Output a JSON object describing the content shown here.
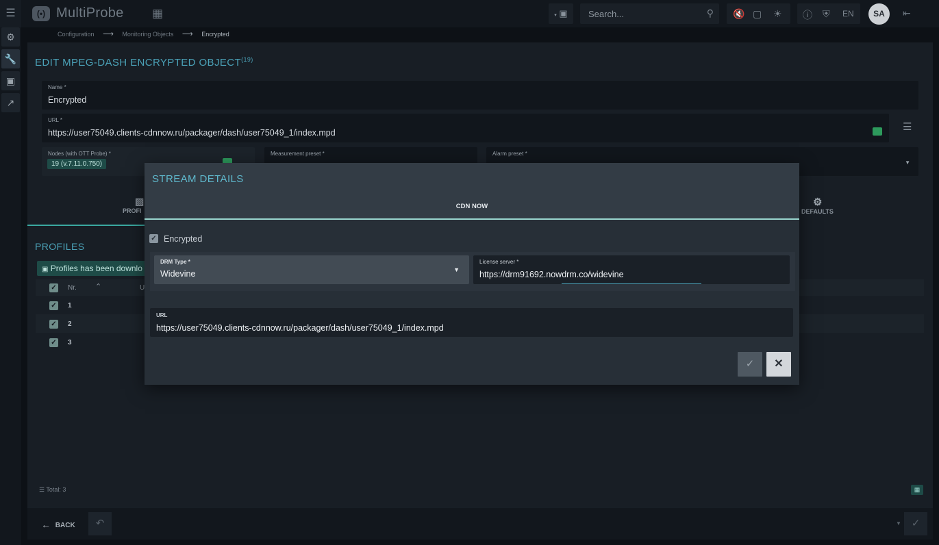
{
  "app": {
    "logo_mark": "(•)",
    "name": "MultiProbe"
  },
  "header": {
    "search_placeholder": "Search...",
    "language": "EN",
    "user_initials": "SA"
  },
  "breadcrumb": [
    "Configuration",
    "Monitoring Objects",
    "Encrypted"
  ],
  "page": {
    "title": "EDIT MPEG-DASH ENCRYPTED OBJECT",
    "title_count": "(19)"
  },
  "form": {
    "name_label": "Name *",
    "name_value": "Encrypted",
    "url_label": "URL *",
    "url_value": "https://user75049.clients-cdnnow.ru/packager/dash/user75049_1/index.mpd",
    "nodes_label": "Nodes (with OTT Probe) *",
    "nodes_value": "19 (v.7.11.0.750)",
    "measurement_label": "Measurement preset *",
    "alarm_label": "Alarm preset *"
  },
  "bg_tabs": {
    "profiles": "PROFI",
    "defaults": "DEFAULTS"
  },
  "profiles": {
    "title": "PROFILES",
    "banner": "Profiles has been downlo",
    "col_nr": "Nr.",
    "col_u": "U",
    "rows": [
      {
        "nr": "1"
      },
      {
        "nr": "2"
      },
      {
        "nr": "3"
      }
    ],
    "total": "Total: 3"
  },
  "footer": {
    "back_label": "BACK"
  },
  "modal": {
    "title": "STREAM DETAILS",
    "tab": "CDN NOW",
    "encrypted_label": "Encrypted",
    "drm_label": "DRM Type *",
    "drm_value": "Widevine",
    "license_label": "License server *",
    "license_value": "https://drm91692.nowdrm.co/widevine",
    "url_label": "URL",
    "url_value": "https://user75049.clients-cdnnow.ru/packager/dash/user75049_1/index.mpd"
  },
  "colors": {
    "accent_teal": "#4ba2b8",
    "chip_green": "#1e4b47",
    "tab_underline": "#9ad7cf"
  }
}
